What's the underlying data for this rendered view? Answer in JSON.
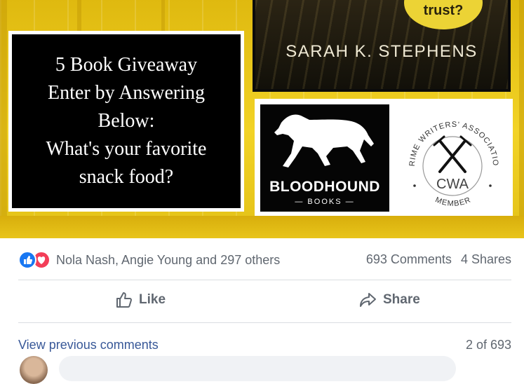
{
  "post_image": {
    "cover": {
      "trust_text": "trust?",
      "author": "SARAH K. STEPHENS"
    },
    "giveaway_lines": [
      "5 Book Giveaway",
      "Enter by Answering",
      "Below:",
      "What's your favorite",
      "snack food?"
    ],
    "bloodhound": {
      "title": "BLOODHOUND",
      "subtitle": "— BOOKS —"
    },
    "cwa": {
      "arc_text": "CRIME WRITERS' ASSOCIATION",
      "center": "CWA",
      "bottom": "MEMBER"
    }
  },
  "reactions": {
    "icons": [
      "like-icon",
      "love-icon"
    ],
    "names": "Nola Nash, Angie Young and 297 others",
    "comments": "693 Comments",
    "shares": "4 Shares"
  },
  "actions": {
    "like": "Like",
    "share": "Share"
  },
  "comments": {
    "view_previous": "View previous comments",
    "page": "2 of 693"
  },
  "colors": {
    "like_blue": "#1877f2",
    "love_red": "#f33e58",
    "link": "#385898",
    "meta_gray": "#606770"
  }
}
